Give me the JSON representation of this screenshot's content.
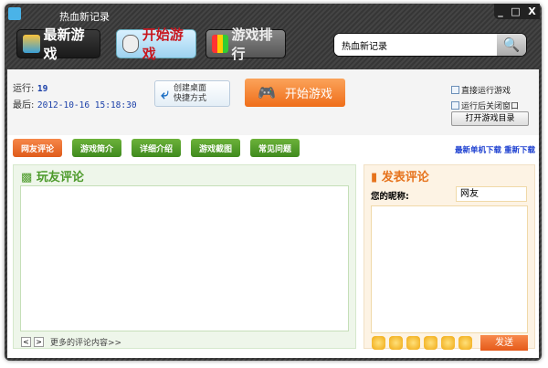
{
  "window": {
    "title": "热血新记录",
    "min": "_",
    "max": "□",
    "close": "X"
  },
  "nav": [
    {
      "label": "最新游戏"
    },
    {
      "label": "开始游戏"
    },
    {
      "label": "游戏排行"
    }
  ],
  "search": {
    "value": "热血新记录"
  },
  "info": {
    "run_label": "运行:",
    "run_value": "19",
    "last_label": "最后:",
    "last_value": "2012-10-16 15:18:30"
  },
  "shortcut": {
    "line1": "创建桌面",
    "line2": "快捷方式"
  },
  "start_button": "开始游戏",
  "options": {
    "direct_run": "直接运行游戏",
    "close_after": "运行后关闭窗口",
    "open_dir": "打开游戏目录"
  },
  "tabs": [
    {
      "label": "网友评论"
    },
    {
      "label": "游戏简介"
    },
    {
      "label": "详细介绍"
    },
    {
      "label": "游戏截图"
    },
    {
      "label": "常见问题"
    }
  ],
  "links": {
    "latest": "最新单机下载",
    "redownload": "重新下载"
  },
  "comments": {
    "title": "玩友评论",
    "prev": "<",
    "next": ">",
    "more": "更多的评论内容>>"
  },
  "post": {
    "title": "发表评论",
    "nick_label": "您的昵称:",
    "nick_value": "网友",
    "send": "发送"
  },
  "colors": {
    "accent": "#ef6e1a",
    "green": "#4c9a2a",
    "link": "#1c3fd0"
  }
}
